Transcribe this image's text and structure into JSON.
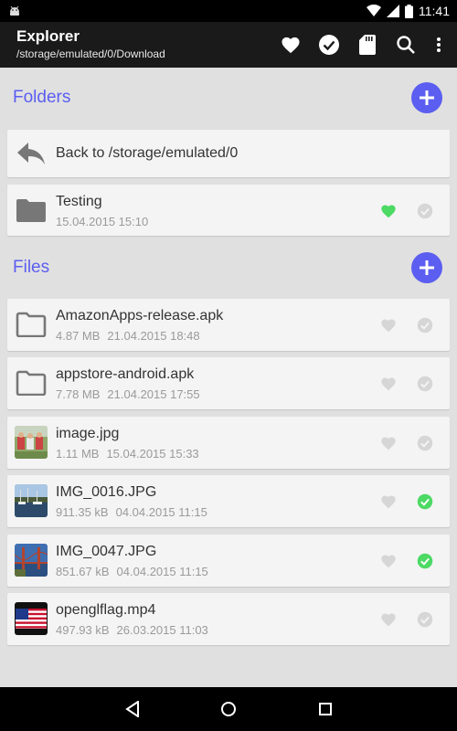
{
  "status_bar": {
    "time": "11:41"
  },
  "app_bar": {
    "title": "Explorer",
    "subtitle": "/storage/emulated/0/Download"
  },
  "folders_section": {
    "label": "Folders"
  },
  "back_row": {
    "label": "Back to /storage/emulated/0"
  },
  "folders": [
    {
      "name": "Testing",
      "meta": "15.04.2015 15:10",
      "favorite": true,
      "selected": false
    }
  ],
  "files_section": {
    "label": "Files"
  },
  "files": [
    {
      "name": "AmazonApps-release.apk",
      "size": "4.87 MB",
      "date": "21.04.2015 18:48",
      "thumb": "folder-icon",
      "favorite": false,
      "selected": false
    },
    {
      "name": "appstore-android.apk",
      "size": "7.78 MB",
      "date": "21.04.2015 17:55",
      "thumb": "folder-icon",
      "favorite": false,
      "selected": false
    },
    {
      "name": "image.jpg",
      "size": "1.11 MB",
      "date": "15.04.2015 15:33",
      "thumb": "image-thumbnail",
      "favorite": false,
      "selected": false
    },
    {
      "name": "IMG_0016.JPG",
      "size": "911.35 kB",
      "date": "04.04.2015 11:15",
      "thumb": "harbor-thumbnail",
      "favorite": false,
      "selected": true
    },
    {
      "name": "IMG_0047.JPG",
      "size": "851.67 kB",
      "date": "04.04.2015 11:15",
      "thumb": "bridge-thumbnail",
      "favorite": false,
      "selected": true
    },
    {
      "name": "openglflag.mp4",
      "size": "497.93 kB",
      "date": "26.03.2015 11:03",
      "thumb": "flag-thumbnail",
      "favorite": false,
      "selected": false
    }
  ],
  "colors": {
    "accent": "#5b5ef0",
    "check_on": "#4cd964",
    "heart_on": "#4cd964",
    "inactive": "#cfcfcf"
  }
}
